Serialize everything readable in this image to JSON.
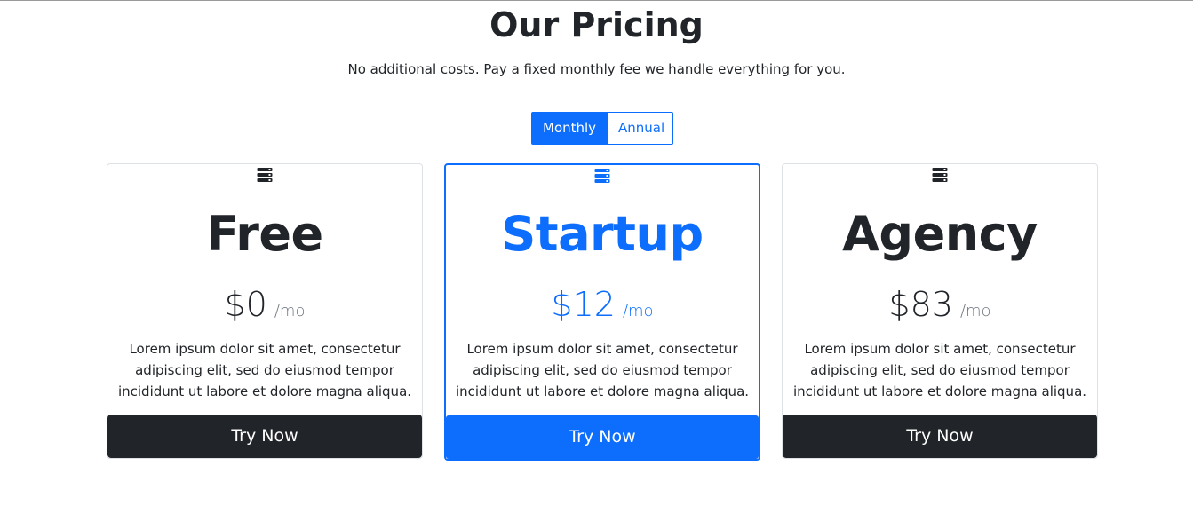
{
  "header": {
    "title": "Our Pricing",
    "subtitle": "No additional costs. Pay a fixed monthly fee we handle everything for you."
  },
  "billing_toggle": {
    "options": [
      "Monthly",
      "Annual"
    ],
    "selected": "Monthly"
  },
  "plans": [
    {
      "name": "Free",
      "price": "$0",
      "unit": "/mo",
      "description": "Lorem ipsum dolor sit amet, consectetur adipiscing elit, sed do eiusmod tempor incididunt ut labore et dolore magna aliqua.",
      "cta": "Try Now",
      "icon": "server-icon",
      "featured": false
    },
    {
      "name": "Startup",
      "price": "$12",
      "unit": "/mo",
      "description": "Lorem ipsum dolor sit amet, consectetur adipiscing elit, sed do eiusmod tempor incididunt ut labore et dolore magna aliqua.",
      "cta": "Try Now",
      "icon": "server-icon",
      "featured": true
    },
    {
      "name": "Agency",
      "price": "$83",
      "unit": "/mo",
      "description": "Lorem ipsum dolor sit amet, consectetur adipiscing elit, sed do eiusmod tempor incididunt ut labore et dolore magna aliqua.",
      "cta": "Try Now",
      "icon": "server-icon",
      "featured": false
    }
  ],
  "colors": {
    "primary": "#0d6efd",
    "dark": "#212529",
    "muted": "#6c757d"
  }
}
